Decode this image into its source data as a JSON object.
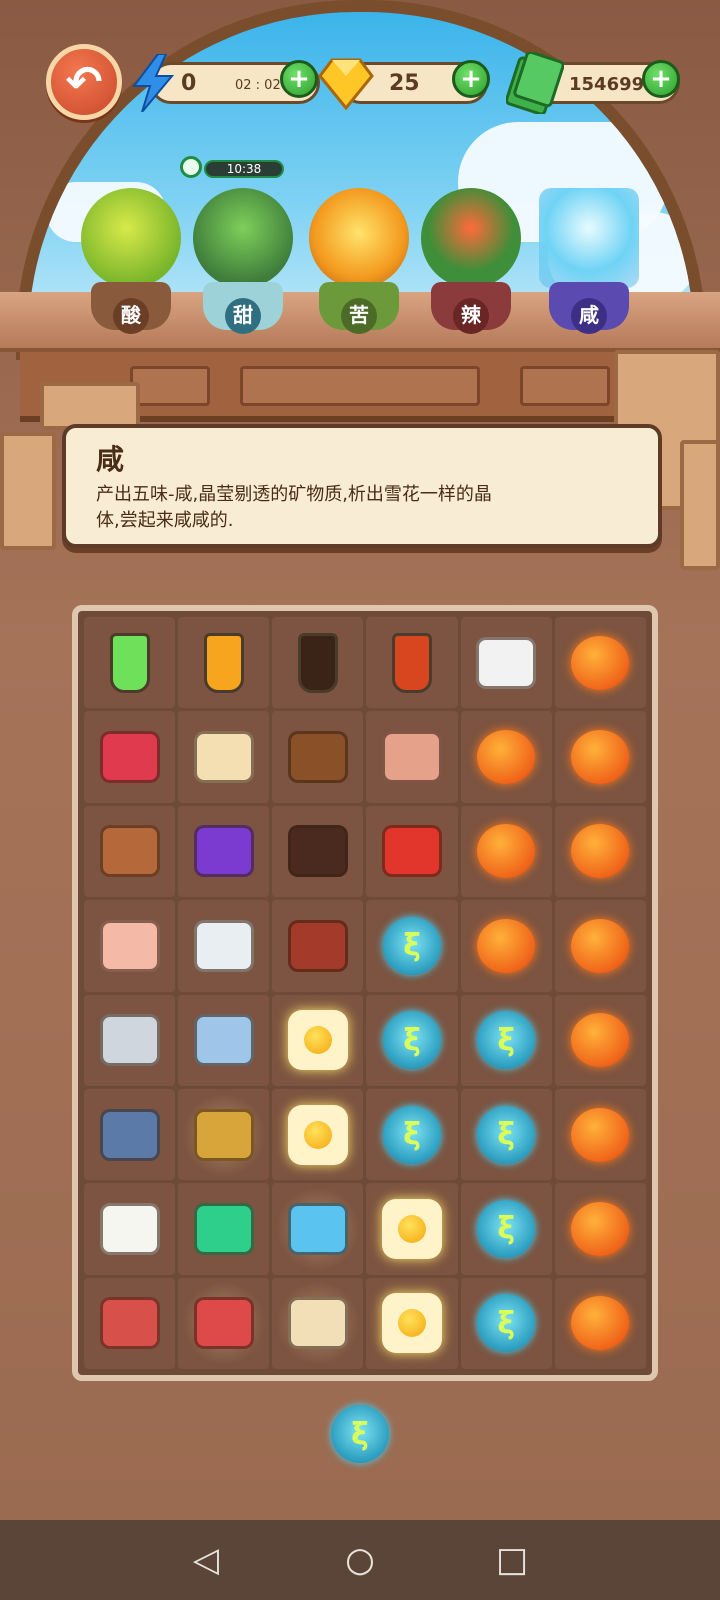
{
  "colors": {
    "accent_green": "#2f9e2c",
    "back_button": "#c9482a",
    "panel_bg": "#f8edd4",
    "orb": "#f0651a",
    "bubble": "#2b9dc0"
  },
  "topbar": {
    "back_icon": "back-arrow-icon",
    "energy": {
      "icon": "lightning-icon",
      "value": "0",
      "timer": "02 : 02"
    },
    "gems": {
      "icon": "gem-icon",
      "value": "25"
    },
    "cash": {
      "icon": "cash-icon",
      "value": "154699"
    },
    "plus_label": "+"
  },
  "cooldown": {
    "icon": "clock-icon",
    "value": "10:38"
  },
  "plants": [
    {
      "label": "酸",
      "icon": "lemon-tree-icon"
    },
    {
      "label": "甜",
      "icon": "sugarcane-icon"
    },
    {
      "label": "苦",
      "icon": "bitter-tree-icon"
    },
    {
      "label": "辣",
      "icon": "chili-plant-icon"
    },
    {
      "label": "咸",
      "icon": "salt-crystal-icon"
    }
  ],
  "description": {
    "title": "咸",
    "text": "产出五味-咸,晶莹剔透的矿物质,析出雪花一样的晶体,尝起来咸咸的."
  },
  "grid": [
    [
      "green-potion-icon",
      "honey-jar-icon",
      "soy-sauce-bottle-icon",
      "chili-oil-bottle-icon",
      "salted-egg-icon",
      "orange-orb-icon"
    ],
    [
      "raspberry-branch-icon",
      "cream-puff-icon",
      "coffee-beans-icon",
      "dried-fish-fillet-icon",
      "orange-orb-icon",
      "orange-orb-icon"
    ],
    [
      "brown-sugar-icon",
      "candy-icon",
      "chocolate-icon",
      "hawthorn-icon",
      "orange-orb-icon",
      "orange-orb-icon"
    ],
    [
      "rock-salt-bowl-icon",
      "salt-bowl-icon",
      "cured-ham-icon",
      "sprout-bubble-icon",
      "orange-orb-icon",
      "orange-orb-icon"
    ],
    [
      "cd-case-icon",
      "smartphone-icon",
      "egg-token-icon",
      "sprout-bubble-icon",
      "sprout-bubble-icon",
      "orange-orb-icon"
    ],
    [
      "fish-icon",
      "key-icon",
      "egg-token-icon",
      "sprout-bubble-icon",
      "sprout-bubble-icon",
      "orange-orb-icon"
    ],
    [
      "mahjong-tile-icon",
      "lighter-icon",
      "dolphin-toy-icon",
      "egg-token-icon",
      "sprout-bubble-icon",
      "orange-orb-icon"
    ],
    [
      "game-console-icon",
      "red-wallet-icon",
      "vinyl-record-icon",
      "egg-token-icon",
      "sprout-bubble-icon",
      "orange-orb-icon"
    ]
  ],
  "loose_item": "sprout-bubble-icon",
  "navbar": {
    "back": "nav-back-icon",
    "home": "nav-home-icon",
    "recents": "nav-recents-icon"
  }
}
